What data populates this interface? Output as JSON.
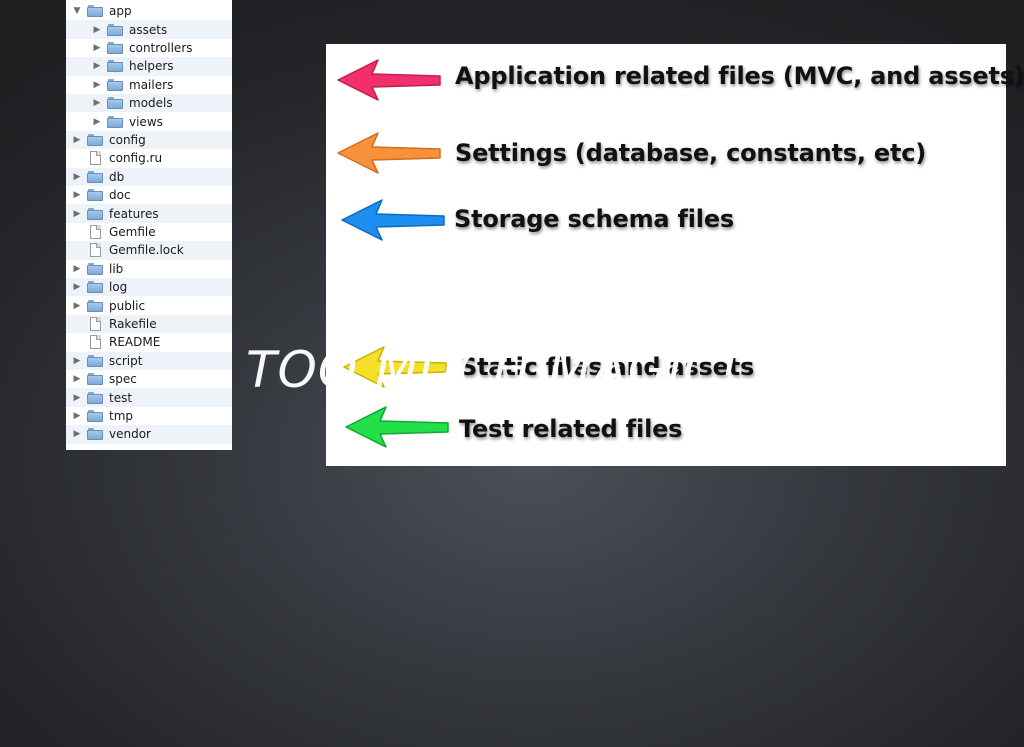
{
  "tree": {
    "items": [
      {
        "label": "app",
        "type": "folder",
        "indent": 0,
        "expander": "down"
      },
      {
        "label": "assets",
        "type": "folder",
        "indent": 1,
        "expander": "right"
      },
      {
        "label": "controllers",
        "type": "folder",
        "indent": 1,
        "expander": "right"
      },
      {
        "label": "helpers",
        "type": "folder",
        "indent": 1,
        "expander": "right"
      },
      {
        "label": "mailers",
        "type": "folder",
        "indent": 1,
        "expander": "right"
      },
      {
        "label": "models",
        "type": "folder",
        "indent": 1,
        "expander": "right"
      },
      {
        "label": "views",
        "type": "folder",
        "indent": 1,
        "expander": "right"
      },
      {
        "label": "config",
        "type": "folder",
        "indent": 0,
        "expander": "right"
      },
      {
        "label": "config.ru",
        "type": "file",
        "indent": 0,
        "expander": "none"
      },
      {
        "label": "db",
        "type": "folder",
        "indent": 0,
        "expander": "right"
      },
      {
        "label": "doc",
        "type": "folder",
        "indent": 0,
        "expander": "right"
      },
      {
        "label": "features",
        "type": "folder",
        "indent": 0,
        "expander": "right"
      },
      {
        "label": "Gemfile",
        "type": "file",
        "indent": 0,
        "expander": "none"
      },
      {
        "label": "Gemfile.lock",
        "type": "file",
        "indent": 0,
        "expander": "none"
      },
      {
        "label": "lib",
        "type": "folder",
        "indent": 0,
        "expander": "right"
      },
      {
        "label": "log",
        "type": "folder",
        "indent": 0,
        "expander": "right"
      },
      {
        "label": "public",
        "type": "folder",
        "indent": 0,
        "expander": "right"
      },
      {
        "label": "Rakefile",
        "type": "file",
        "indent": 0,
        "expander": "none"
      },
      {
        "label": "README",
        "type": "file",
        "indent": 0,
        "expander": "none"
      },
      {
        "label": "script",
        "type": "folder",
        "indent": 0,
        "expander": "right"
      },
      {
        "label": "spec",
        "type": "folder",
        "indent": 0,
        "expander": "right"
      },
      {
        "label": "test",
        "type": "folder",
        "indent": 0,
        "expander": "right"
      },
      {
        "label": "tmp",
        "type": "folder",
        "indent": 0,
        "expander": "right"
      },
      {
        "label": "vendor",
        "type": "folder",
        "indent": 0,
        "expander": "right"
      }
    ]
  },
  "annotations": [
    {
      "text": "Application related files (MVC, and assets)",
      "color": "#f0306a",
      "icon": "arrow-left-icon"
    },
    {
      "text": "Settings (database, constants, etc)",
      "color": "#f7923a",
      "icon": "arrow-left-icon"
    },
    {
      "text": "Storage schema files",
      "color": "#1b8ef0",
      "icon": "arrow-left-icon"
    },
    {
      "text": "Static files and assets",
      "color": "#f4df2a",
      "icon": "arrow-left-icon"
    },
    {
      "text": "Test related files",
      "color": "#22e04a",
      "icon": "arrow-left-icon"
    }
  ],
  "headline": "TOO MUCH MAGIC!"
}
